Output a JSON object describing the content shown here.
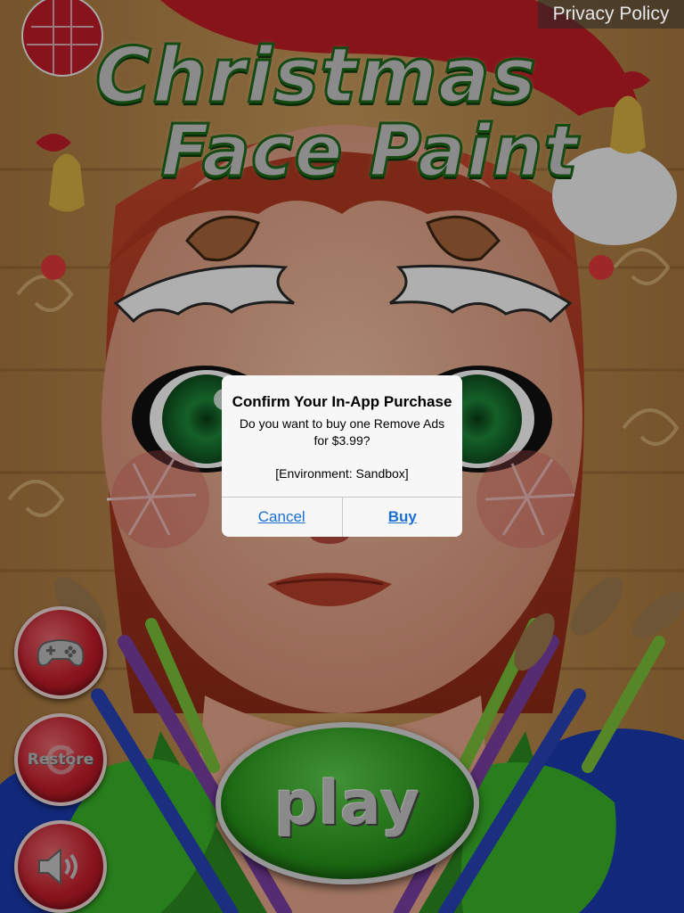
{
  "app": {
    "title_line1": "Christmas",
    "title_line2": "Face Paint",
    "privacy_label": "Privacy Policy"
  },
  "menu": {
    "games_icon": "gamepad-icon",
    "restore_label": "Restore",
    "restore_icon": "refresh-icon",
    "sound_icon": "speaker-icon",
    "play_label": "play"
  },
  "alert": {
    "title": "Confirm Your In-App Purchase",
    "message": "Do you want to buy one Remove Ads for $3.99?",
    "environment": "[Environment: Sandbox]",
    "cancel_label": "Cancel",
    "buy_label": "Buy"
  },
  "colors": {
    "button_red": "#c51d2b",
    "play_green": "#2a9a1d",
    "link_blue": "#1a6fd6"
  }
}
